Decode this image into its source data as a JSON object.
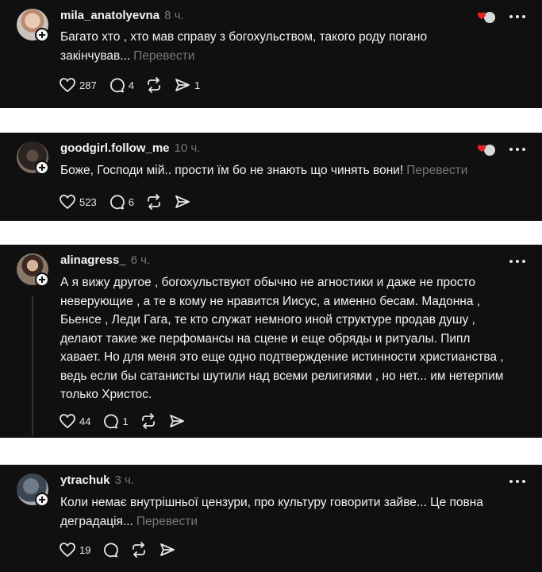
{
  "colors": {
    "card_bg": "#101010",
    "text": "#f3f3f3",
    "muted": "#777777",
    "page_bg": "#ffffff"
  },
  "comments": [
    {
      "username": "mila_anatolyevna",
      "time": "8 ч.",
      "lines": [
        "Багато хто , хто мав справу з богохульством, такого роду погано",
        "закінчував..."
      ],
      "translate": "Перевести",
      "likes": "287",
      "replies": "4",
      "reposts": "",
      "shares": "1",
      "has_badge": true
    },
    {
      "username": "goodgirl.follow_me",
      "time": "10 ч.",
      "lines": [
        "Боже, Господи мій.. прости їм бо не знають що чинять вони!"
      ],
      "translate": "Перевести",
      "likes": "523",
      "replies": "6",
      "reposts": "",
      "shares": "",
      "has_badge": true
    },
    {
      "username": "alinagress_",
      "time": "6 ч.",
      "lines": [
        "А я вижу другое , богохульствуют обычно не агностики и даже не просто",
        "неверующие , а те в кому не нравится Иисус, а именно бесам. Мадонна ,",
        "Бьенсе , Леди Гага, те кто служат немного иной структуре продав душу ,",
        "делают такие же перфомансы на сцене и еще обряды и ритуалы. Пипл",
        "хавает. Но для меня это еще одно подтверждение истинности христианства ,",
        "ведь если бы сатанисты шутили над всеми религиями , но нет... им нетерпим",
        "только Христос."
      ],
      "translate": "",
      "likes": "44",
      "replies": "1",
      "reposts": "",
      "shares": "",
      "has_badge": false
    },
    {
      "username": "ytrachuk",
      "time": "3 ч.",
      "lines": [
        "Коли немає внутрішньої цензури, про культуру говорити зайве... Це повна",
        "деградація..."
      ],
      "translate": "Перевести",
      "likes": "19",
      "replies": "",
      "reposts": "",
      "shares": "",
      "has_badge": false
    }
  ]
}
